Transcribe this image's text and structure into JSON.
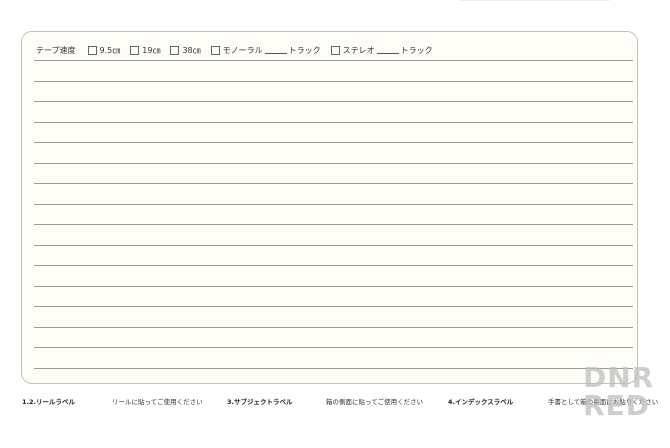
{
  "header": {
    "title": "テープ速度",
    "options": [
      {
        "label": "9.5㎝",
        "checked": false
      },
      {
        "label": "19㎝",
        "checked": false
      },
      {
        "label": "38㎝",
        "checked": false
      },
      {
        "label_before": "モノーラル",
        "label_after": "トラック",
        "checked": false
      },
      {
        "label_before": "ステレオ",
        "label_after": "トラック",
        "checked": false
      }
    ]
  },
  "footer": {
    "label_2": "1.2.リールラベル",
    "note_2": "リールに貼ってご使用ください",
    "label_3": "3.サブジェクトラベル",
    "note_3": "箱の側面に貼ってご使用ください",
    "label_4": "4.インデックスラベル",
    "note_4": "手書として箱の裏面にお貼りください"
  },
  "watermark": {
    "line1": "DNR",
    "line2": "RED",
    "color": "#bebebe"
  }
}
